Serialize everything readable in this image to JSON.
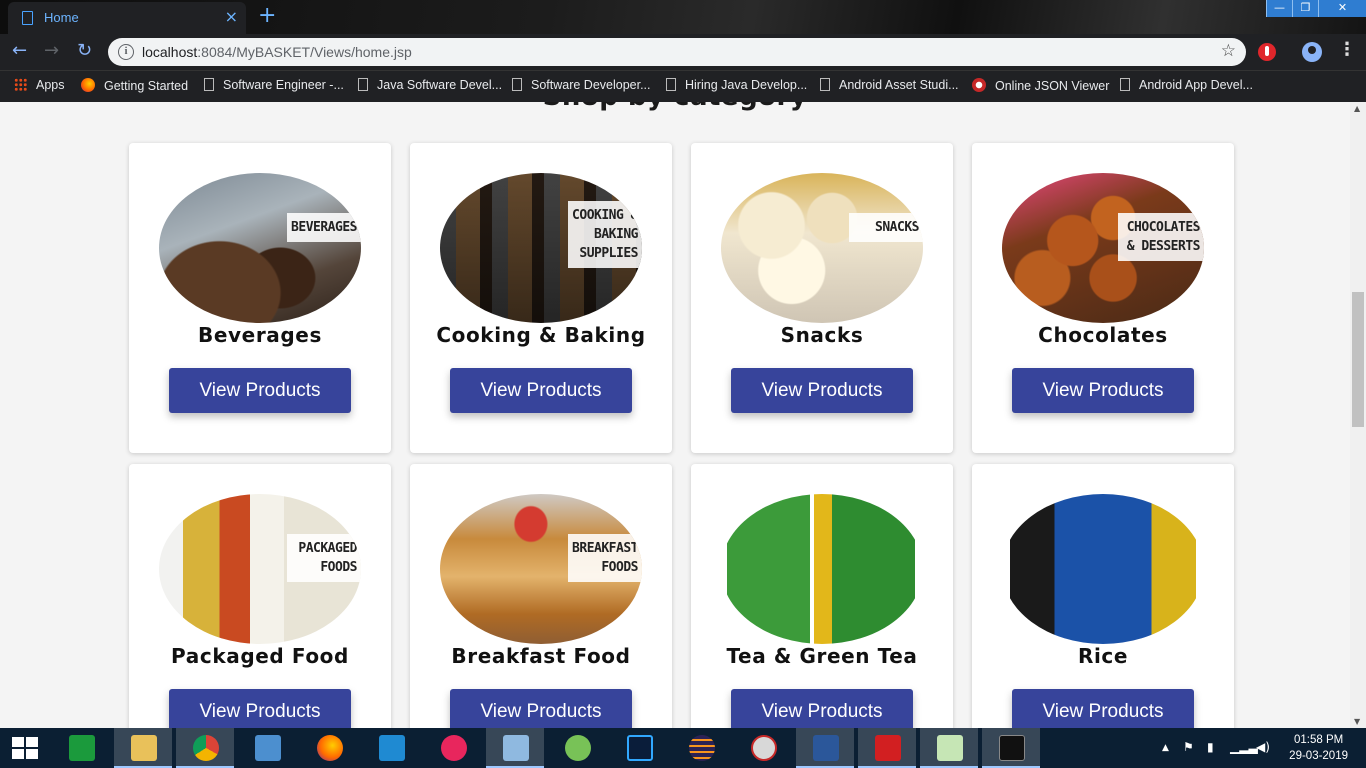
{
  "browser": {
    "tab_title": "Home",
    "tab_close": "×",
    "new_tab": "+",
    "url_host": "localhost",
    "url_rest": ":8084/MyBASKET/Views/home.jsp",
    "window_controls": [
      "—",
      "❐",
      "✕"
    ],
    "bookmarks": [
      {
        "label": "Apps",
        "icon": "apps-grid-icon"
      },
      {
        "label": "Getting Started",
        "icon": "firefox-icon"
      },
      {
        "label": "Software Engineer -...",
        "icon": "page-icon"
      },
      {
        "label": "Java Software Devel...",
        "icon": "page-icon"
      },
      {
        "label": "Software Developer...",
        "icon": "page-icon"
      },
      {
        "label": "Hiring Java Develop...",
        "icon": "page-icon"
      },
      {
        "label": "Android Asset Studi...",
        "icon": "page-icon"
      },
      {
        "label": "Online JSON Viewer",
        "icon": "json-icon"
      },
      {
        "label": "Android App Devel...",
        "icon": "page-icon"
      }
    ]
  },
  "page": {
    "section_title": "Shop by category",
    "categories": [
      {
        "name": "Beverages",
        "tag": "BEVERAGES",
        "button": "View Products"
      },
      {
        "name": "Cooking & Baking",
        "tag": "COOKING &\nBAKING\nSUPPLIES",
        "button": "View Products"
      },
      {
        "name": "Snacks",
        "tag": "SNACKS",
        "button": "View Products"
      },
      {
        "name": "Chocolates",
        "tag": "CHOCOLATES\n& DESSERTS",
        "button": "View Products"
      },
      {
        "name": "Packaged Food",
        "tag": "PACKAGED\nFOODS",
        "button": "View Products"
      },
      {
        "name": "Breakfast Food",
        "tag": "BREAKFAST\nFOODS",
        "button": "View Products"
      },
      {
        "name": "Tea & Green Tea",
        "tag": "",
        "button": "View Products"
      },
      {
        "name": "Rice",
        "tag": "",
        "button": "View Products"
      }
    ]
  },
  "taskbar": {
    "time": "01:58 PM",
    "date": "29-03-2019",
    "apps": [
      "windows-store",
      "file-explorer",
      "chrome",
      "control-panel",
      "firefox",
      "vscode",
      "flickr",
      "virtualbox",
      "android-studio",
      "photoshop",
      "eclipse",
      "snipping-tool",
      "word",
      "acrobat",
      "notepad",
      "mysql"
    ]
  }
}
